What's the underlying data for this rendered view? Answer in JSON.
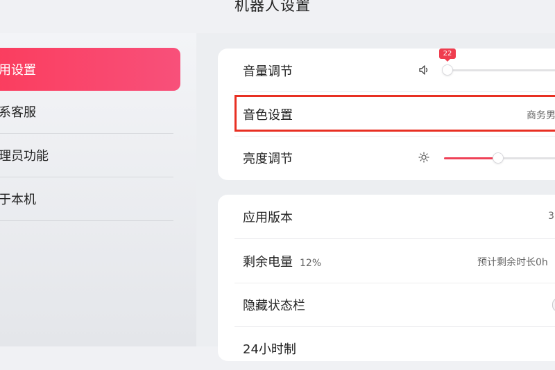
{
  "header": {
    "title": "机器人设置"
  },
  "sidebar": {
    "items": [
      {
        "label": "用设置",
        "active": true
      },
      {
        "label": "系客服",
        "active": false
      },
      {
        "label": "理员功能",
        "active": false
      },
      {
        "label": "于本机",
        "active": false
      }
    ]
  },
  "settings_card_1": {
    "volume": {
      "label": "音量调节",
      "value": 22,
      "value_label": "22",
      "icon": "speaker-icon"
    },
    "voice": {
      "label": "音色设置",
      "value": "商务男"
    },
    "brightness": {
      "label": "亮度调节",
      "value_fraction": 0.3,
      "icon": "sun-icon"
    }
  },
  "settings_card_2": {
    "app_version": {
      "label": "应用版本",
      "value": "3"
    },
    "battery": {
      "label": "剩余电量",
      "percent": "12%",
      "estimate": "预计剩余时长0h"
    },
    "hide_status_bar": {
      "label": "隐藏状态栏"
    },
    "clock_24h": {
      "label": "24小时制"
    }
  },
  "colors": {
    "accent": "#f8415f",
    "highlight_border": "#e83023"
  }
}
